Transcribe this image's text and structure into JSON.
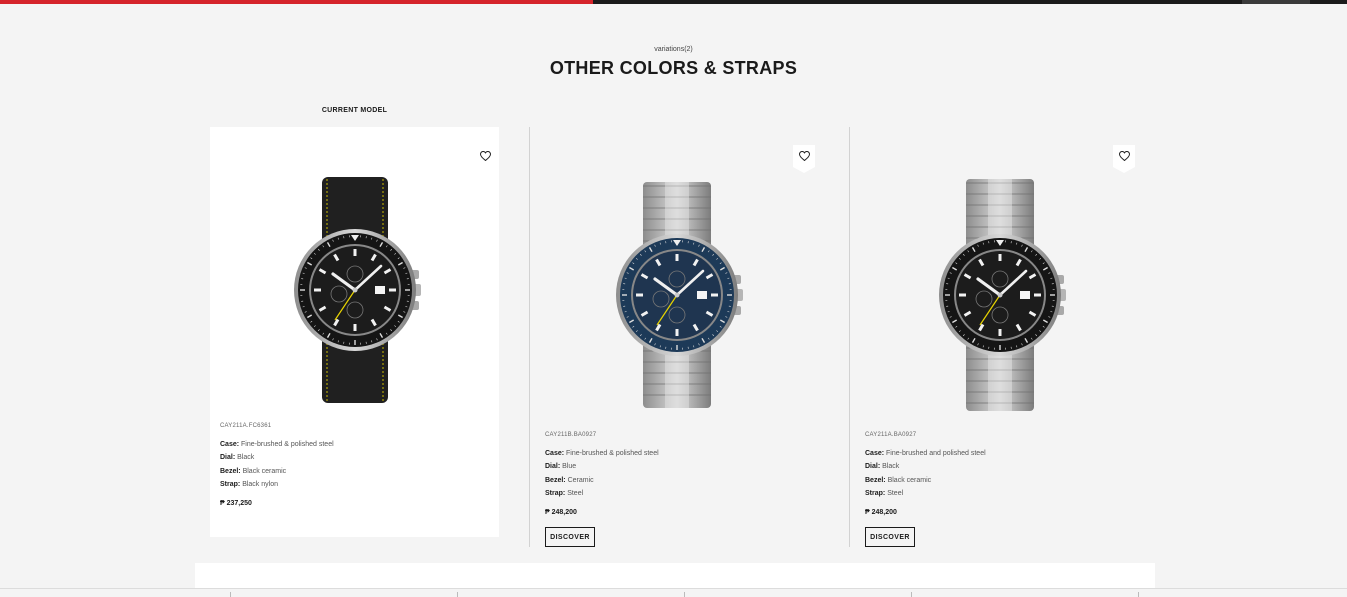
{
  "header": {
    "subtitle": "variations(2)",
    "title": "OTHER COLORS & STRAPS",
    "current_label": "CURRENT MODEL"
  },
  "progress": {
    "fraction": 0.44
  },
  "spec_labels": {
    "case": "Case:",
    "dial": "Dial:",
    "bezel": "Bezel:",
    "strap": "Strap:"
  },
  "cards": [
    {
      "ref": "CAY211A.FC6361",
      "case": "Fine-brushed & polished steel",
      "dial": "Black",
      "bezel": "Black ceramic",
      "strap": "Black nylon",
      "price": "₱ 237,250",
      "dial_color": "#1c1c1c",
      "bezel_color": "#151515",
      "strap_type": "nylon"
    },
    {
      "ref": "CAY211B.BA0927",
      "case": "Fine-brushed & polished steel",
      "dial": "Blue",
      "bezel": "Ceramic",
      "strap": "Steel",
      "price": "₱ 248,200",
      "discover": "DISCOVER",
      "dial_color": "#1f3550",
      "bezel_color": "#1d3a58",
      "strap_type": "steel"
    },
    {
      "ref": "CAY211A.BA0927",
      "case": "Fine-brushed and polished steel",
      "dial": "Black",
      "bezel": "Black ceramic",
      "strap": "Steel",
      "price": "₱ 248,200",
      "discover": "DISCOVER",
      "dial_color": "#1c1c1c",
      "bezel_color": "#151515",
      "strap_type": "steel"
    }
  ],
  "colors": {
    "accent_red": "#d5242b",
    "background": "#f4f4f4",
    "card_current": "#ffffff"
  },
  "icons": {
    "favorite": "heart-icon"
  }
}
